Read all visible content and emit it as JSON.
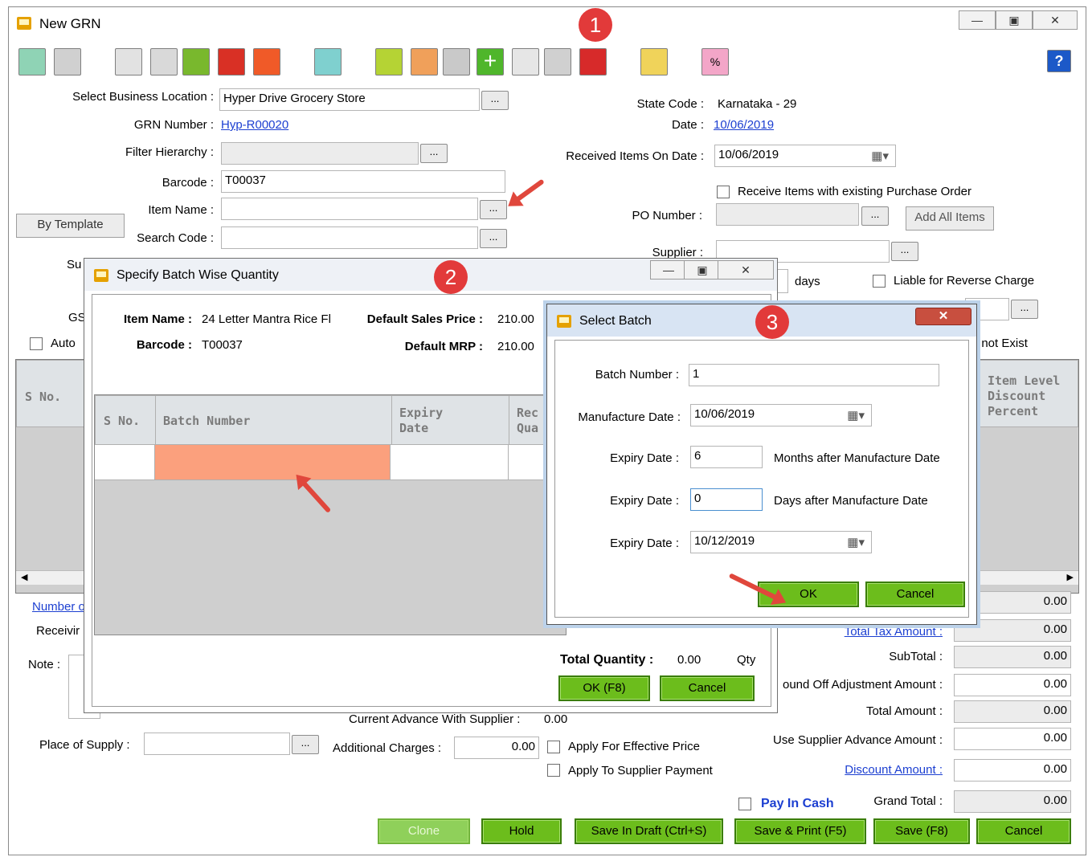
{
  "window": {
    "title": "New GRN",
    "help": "?"
  },
  "badges": [
    "1",
    "2",
    "3"
  ],
  "form": {
    "location_label": "Select Business Location :",
    "location_value": "Hyper Drive Grocery Store",
    "grn_label": "GRN Number :",
    "grn_value": "Hyp-R00020",
    "filter_label": "Filter Hierarchy :",
    "barcode_label": "Barcode :",
    "barcode_value": "T00037",
    "item_label": "Item Name :",
    "search_label": "Search Code :",
    "by_template": "By Template",
    "state_label": "State Code :",
    "state_value": "Karnataka - 29",
    "date_label": "Date :",
    "date_value": "10/06/2019",
    "received_label": "Received Items On Date :",
    "received_value": "10/06/2019",
    "receive_po_label": "Receive Items with existing Purchase Order",
    "po_label": "PO Number :",
    "add_all": "Add All Items",
    "supplier_label": "Supplier :",
    "days_label": "days",
    "reverse_label": "Liable for Reverse Charge",
    "not_exist": "f not Exist",
    "su_frag": "Su",
    "gs_frag": "GS",
    "auto_frag": "Auto",
    "dots": "..."
  },
  "main_grid": {
    "sno": "S No.",
    "item_level": "Item Level Discount Percent"
  },
  "bottom": {
    "number_frag": "Number o",
    "receiving_frag": "Receivir",
    "note_label": "Note :",
    "advance_label": "Current Advance With Supplier :",
    "advance_value": "0.00",
    "place_label": "Place of Supply :",
    "add_charges_label": "Additional Charges :",
    "add_charges_value": "0.00",
    "apply_eff": "Apply For Effective Price",
    "apply_sup": "Apply To Supplier Payment",
    "pay_cash": "Pay In Cash",
    "totals": [
      {
        "label": "",
        "value": "0.00"
      },
      {
        "label": "Total Tax Amount :",
        "value": "0.00",
        "link": true
      },
      {
        "label": "SubTotal :",
        "value": "0.00"
      },
      {
        "label": "ound Off Adjustment Amount :",
        "value": "0.00"
      },
      {
        "label": "Total Amount :",
        "value": "0.00"
      },
      {
        "label": "Use Supplier Advance Amount :",
        "value": "0.00"
      },
      {
        "label": "Discount Amount :",
        "value": "0.00",
        "link": true
      },
      {
        "label": "Grand Total :",
        "value": "0.00"
      }
    ],
    "buttons": [
      "Clone",
      "Hold",
      "Save In Draft (Ctrl+S)",
      "Save & Print (F5)",
      "Save (F8)",
      "Cancel"
    ]
  },
  "batch_dialog": {
    "title": "Specify Batch Wise Quantity",
    "item_label": "Item Name :",
    "item_value": "24 Letter Mantra Rice Fl",
    "barcode_label": "Barcode :",
    "barcode_value": "T00037",
    "dsp_label": "Default Sales Price :",
    "dsp_value": "210.00",
    "mrp_label": "Default MRP :",
    "mrp_value": "210.00",
    "col_sno": "S No.",
    "col_batch": "Batch Number",
    "col_expiry": "Expiry Date",
    "col_rec": "Rec Qua",
    "total_label": "Total Quantity :",
    "total_value": "0.00",
    "total_unit": "Qty",
    "ok": "OK (F8)",
    "cancel": "Cancel"
  },
  "select_batch": {
    "title": "Select Batch",
    "batch_label": "Batch Number :",
    "batch_value": "1",
    "mfg_label": "Manufacture Date :",
    "mfg_value": "10/06/2019",
    "exp1_label": "Expiry Date :",
    "exp1_value": "6",
    "exp1_suffix": "Months after Manufacture Date",
    "exp2_label": "Expiry Date :",
    "exp2_value": "0",
    "exp2_suffix": "Days after Manufacture Date",
    "exp3_label": "Expiry Date :",
    "exp3_value": "10/12/2019",
    "ok": "OK",
    "cancel": "Cancel"
  },
  "colors": {
    "accent_green": "#6cbd1c",
    "highlight_cell": "#fba07d",
    "badge_red": "#e23a3a",
    "link_blue": "#1c3fd1"
  }
}
